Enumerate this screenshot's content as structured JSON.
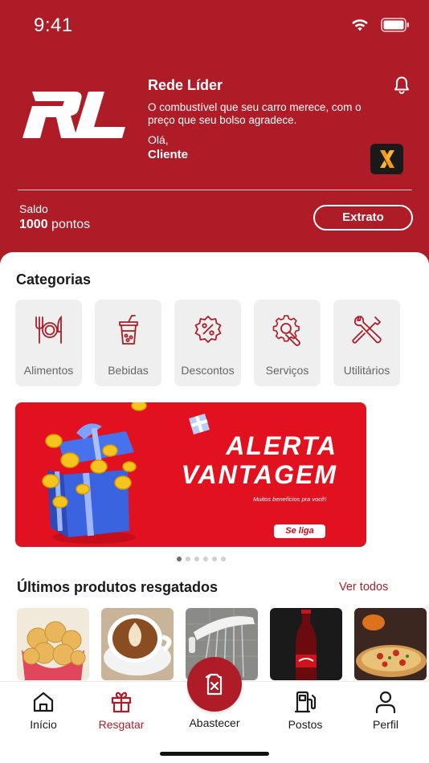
{
  "status_bar": {
    "time": "9:41"
  },
  "header": {
    "brand_name": "Rede Líder",
    "tagline": "O combustível que seu carro merece, com o preço que seu bolso agradece.",
    "greeting": "Olá,",
    "client_name": "Cliente",
    "balance_label": "Saldo",
    "balance_value": "1000",
    "balance_unit": "pontos",
    "extrato_label": "Extrato"
  },
  "categories": {
    "title": "Categorias",
    "items": [
      {
        "label": "Alimentos",
        "icon": "cutlery-plate-icon"
      },
      {
        "label": "Bebidas",
        "icon": "drink-cup-icon"
      },
      {
        "label": "Descontos",
        "icon": "discount-badge-icon"
      },
      {
        "label": "Serviços",
        "icon": "gear-wrench-icon"
      },
      {
        "label": "Utilitários",
        "icon": "tools-icon"
      }
    ]
  },
  "banner": {
    "title_line1": "ALERTA",
    "title_line2": "VANTAGEM",
    "subtitle": "Muitos benefícios pra você!",
    "button_label": "Se liga",
    "pages": 6,
    "active_page": 1
  },
  "products": {
    "title": "Últimos produtos resgatados",
    "see_all_label": "Ver todos",
    "items": [
      {
        "icon": "cheese-bread-image"
      },
      {
        "icon": "cappuccino-image"
      },
      {
        "icon": "shower-head-image"
      },
      {
        "icon": "cola-bottle-image"
      },
      {
        "icon": "pizza-image"
      }
    ]
  },
  "tabbar": {
    "home_label": "Início",
    "redeem_label": "Resgatar",
    "refuel_label": "Abastecer",
    "stations_label": "Postos",
    "profile_label": "Perfil"
  },
  "colors": {
    "brand_red": "#ae1c28",
    "banner_red": "#e1111f"
  }
}
